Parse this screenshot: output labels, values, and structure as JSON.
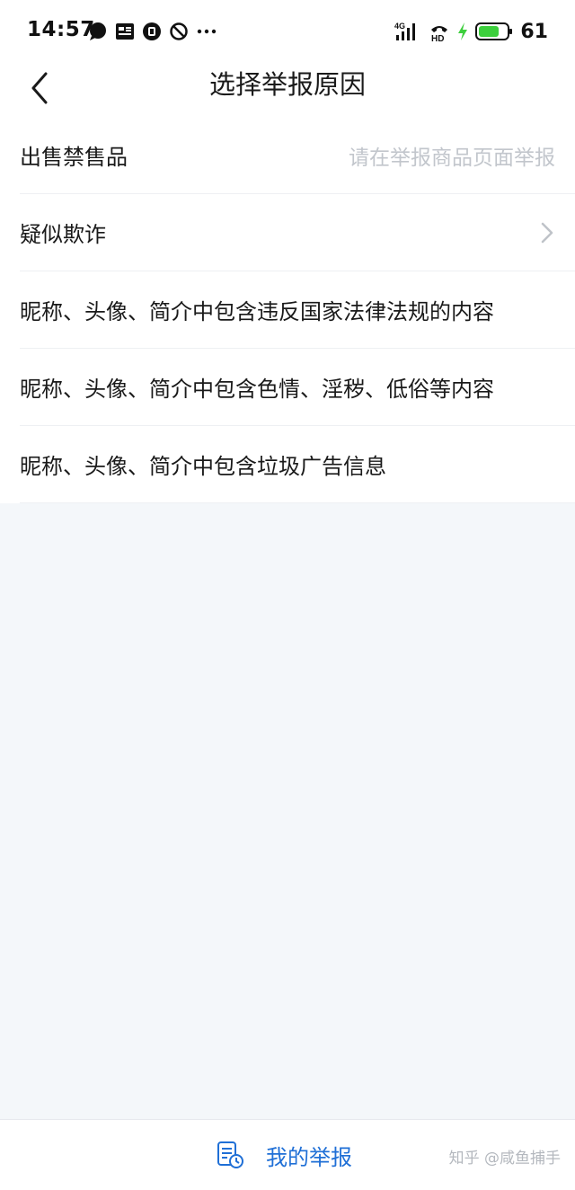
{
  "status_bar": {
    "time": "14:57",
    "battery_level": "61",
    "network": "4G",
    "icons_left": [
      "chat-bubble-icon",
      "news-app-icon",
      "app-notification-icon",
      "do-not-disturb-icon",
      "more-dots-icon"
    ],
    "icons_right": [
      "signal-icon",
      "hd-call-icon",
      "charging-icon",
      "battery-icon"
    ]
  },
  "header": {
    "title": "选择举报原因"
  },
  "reasons": [
    {
      "label": "出售禁售品",
      "hint": "请在举报商品页面举报",
      "has_chevron": false
    },
    {
      "label": "疑似欺诈",
      "hint": "",
      "has_chevron": true
    },
    {
      "label": "昵称、头像、简介中包含违反国家法律法规的内容",
      "hint": "",
      "has_chevron": false
    },
    {
      "label": "昵称、头像、简介中包含色情、淫秽、低俗等内容",
      "hint": "",
      "has_chevron": false
    },
    {
      "label": "昵称、头像、简介中包含垃圾广告信息",
      "hint": "",
      "has_chevron": false
    }
  ],
  "bottom_bar": {
    "my_reports_label": "我的举报",
    "watermark": "知乎 @咸鱼捕手"
  },
  "colors": {
    "accent": "#1f6fd6",
    "hint_text": "#c2c6cc",
    "page_background": "#f4f7fa",
    "battery_green": "#3ccf3c"
  }
}
